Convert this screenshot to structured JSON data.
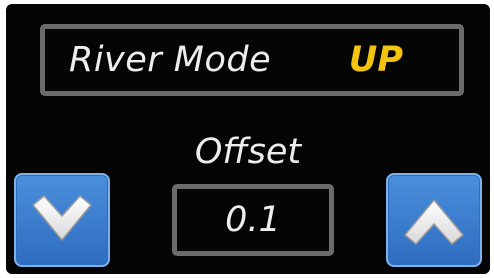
{
  "mode_panel": {
    "label": "River Mode",
    "value": "UP"
  },
  "offset_panel": {
    "title": "Offset",
    "value": "0.1"
  },
  "controls": {
    "decrease_icon": "chevron-down-icon",
    "increase_icon": "chevron-up-icon"
  },
  "colors": {
    "screen_background": "#050505",
    "mode_value": "#f2c40f",
    "text": "#ededed",
    "box_border": "#6b6b6b",
    "button_fill_top": "#4a8fdc",
    "button_fill_bottom": "#2f6cc0"
  }
}
